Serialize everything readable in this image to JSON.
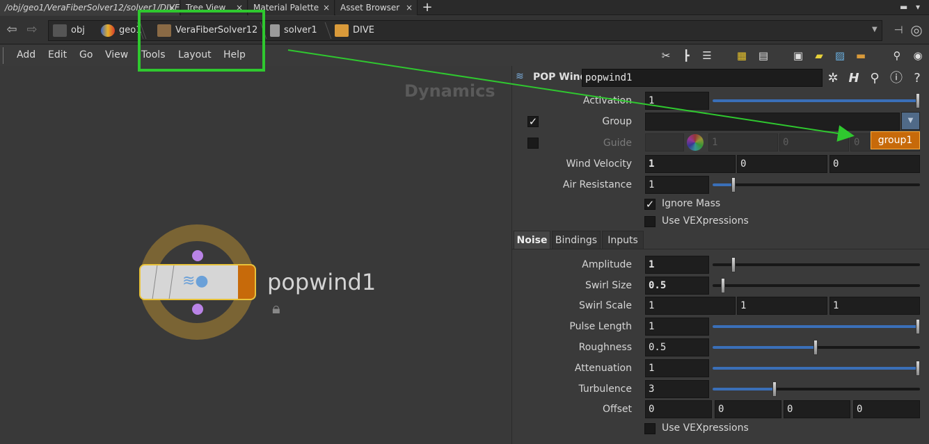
{
  "tabs": [
    {
      "label": "/obj/geo1/VeraFiberSolver12/solver1/DIVE",
      "active": true
    },
    {
      "label": "Tree View",
      "active": false
    },
    {
      "label": "Material Palette",
      "active": false
    },
    {
      "label": "Asset Browser",
      "active": false
    }
  ],
  "tab_close": "×",
  "tab_add": "+",
  "breadcrumbs": [
    {
      "label": "obj",
      "icon": "obj-icon"
    },
    {
      "label": "geo1",
      "icon": "geo-icon"
    },
    {
      "label": "VeraFiberSolver12",
      "icon": "solver-icon"
    },
    {
      "label": "solver1",
      "icon": "solver1-icon"
    },
    {
      "label": "DIVE",
      "icon": "dive-icon"
    }
  ],
  "menu": [
    "Add",
    "Edit",
    "Go",
    "View",
    "Tools",
    "Layout",
    "Help"
  ],
  "network": {
    "context_label": "Dynamics",
    "node_name": "popwind1"
  },
  "params": {
    "node_type": "POP Wind",
    "node_name": "popwind1",
    "activation": {
      "label": "Activation",
      "value": "1",
      "slider": 1.0
    },
    "group": {
      "label": "Group",
      "value": "",
      "checked": true
    },
    "guide": {
      "label": "Guide",
      "values": [
        "1",
        "0",
        "0"
      ],
      "checked": false
    },
    "wind_velocity": {
      "label": "Wind Velocity",
      "values": [
        "1",
        "0",
        "0"
      ]
    },
    "air_resistance": {
      "label": "Air Resistance",
      "value": "1",
      "slider": 0.1
    },
    "ignore_mass": {
      "label": "Ignore Mass",
      "checked": true
    },
    "use_vex_1": {
      "label": "Use VEXpressions",
      "checked": false
    },
    "tabs": [
      "Noise",
      "Bindings",
      "Inputs"
    ],
    "amplitude": {
      "label": "Amplitude",
      "value": "1",
      "slider": 0.1
    },
    "swirl_size": {
      "label": "Swirl Size",
      "value": "0.5",
      "slider": 0.05
    },
    "swirl_scale": {
      "label": "Swirl Scale",
      "values": [
        "1",
        "1",
        "1"
      ]
    },
    "pulse_length": {
      "label": "Pulse Length",
      "value": "1",
      "slider": 1.0
    },
    "roughness": {
      "label": "Roughness",
      "value": "0.5",
      "slider": 0.5
    },
    "attenuation": {
      "label": "Attenuation",
      "value": "1",
      "slider": 1.0
    },
    "turbulence": {
      "label": "Turbulence",
      "value": "3",
      "slider": 0.3
    },
    "offset": {
      "label": "Offset",
      "values": [
        "0",
        "0",
        "0",
        "0"
      ]
    },
    "use_vex_2": {
      "label": "Use VEXpressions",
      "checked": false
    }
  },
  "group_button": "group1"
}
